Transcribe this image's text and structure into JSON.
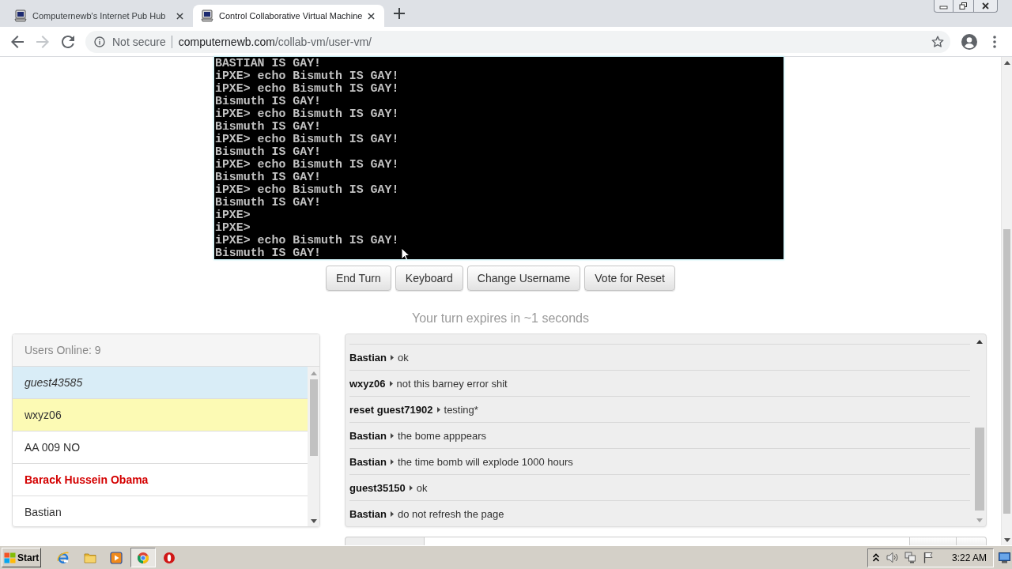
{
  "browser": {
    "tabs": [
      {
        "title": "Computernewb's Internet Pub Hub",
        "selected": false
      },
      {
        "title": "Control Collaborative Virtual Machine",
        "selected": true
      }
    ],
    "forward_disabled": true,
    "security": "Not secure",
    "url": {
      "host": "computernewb.com",
      "path": "/collab-vm/user-vm/"
    }
  },
  "vm_screen": {
    "lines": [
      "BASTIAN IS GAY!",
      "iPXE> echo Bismuth IS GAY!",
      "iPXE> echo Bismuth IS GAY!",
      "Bismuth IS GAY!",
      "iPXE> echo Bismuth IS GAY!",
      "Bismuth IS GAY!",
      "iPXE> echo Bismuth IS GAY!",
      "Bismuth IS GAY!",
      "iPXE> echo Bismuth IS GAY!",
      "Bismuth IS GAY!",
      "iPXE> echo Bismuth IS GAY!",
      "Bismuth IS GAY!",
      "iPXE>",
      "iPXE>",
      "iPXE> echo Bismuth IS GAY!",
      "Bismuth IS GAY!"
    ]
  },
  "vm_buttons": [
    "End Turn",
    "Keyboard",
    "Change Username",
    "Vote for Reset"
  ],
  "turn_status": "Your turn expires in ~1 seconds",
  "users": {
    "header": "Users Online: 9",
    "items": [
      {
        "name": "guest43585",
        "kind": "self"
      },
      {
        "name": "wxyz06",
        "kind": "turn"
      },
      {
        "name": "AA 009 NO",
        "kind": "user"
      },
      {
        "name": "Barack Hussein Obama",
        "kind": "admin"
      },
      {
        "name": "Bastian",
        "kind": "user"
      }
    ]
  },
  "chat": {
    "messages": [
      {
        "user": "Bastian",
        "text": "ok"
      },
      {
        "user": "wxyz06",
        "text": "not this barney error shit"
      },
      {
        "user": "reset guest71902",
        "text": "testing*"
      },
      {
        "user": "Bastian",
        "text": "the bome apppears"
      },
      {
        "user": "Bastian",
        "text": "the time bomb will explode 1000 hours"
      },
      {
        "user": "guest35150",
        "text": "ok"
      },
      {
        "user": "Bastian",
        "text": "do not refresh the page"
      }
    ]
  },
  "taskbar": {
    "start": "Start",
    "apps": [
      {
        "kind": "ie",
        "active": false
      },
      {
        "kind": "folder",
        "active": false
      },
      {
        "kind": "media",
        "active": false
      },
      {
        "kind": "chrome",
        "active": true
      },
      {
        "kind": "ring",
        "active": false
      }
    ],
    "clock": "3:22 AM"
  }
}
